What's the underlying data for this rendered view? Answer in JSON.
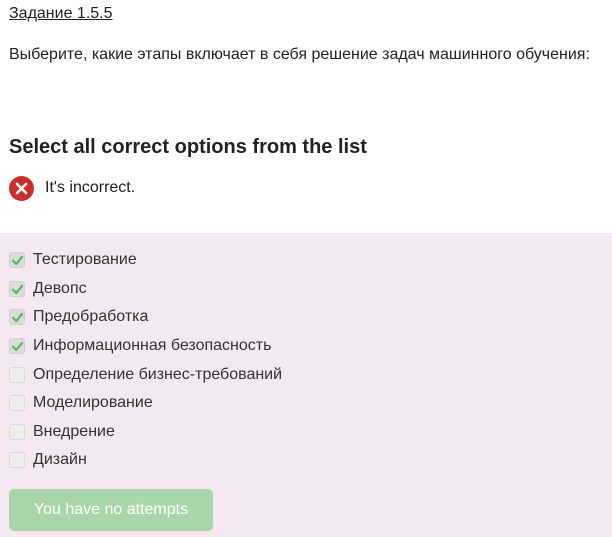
{
  "task": {
    "title": "Задание 1.5.5",
    "question": "Выберите, какие этапы включает в себя решение задач машинного обучения:"
  },
  "quiz": {
    "instruction": "Select all correct options from the list",
    "status_icon": "x-circle-icon",
    "status_color": "#c9302c",
    "status_text": "It's incorrect.",
    "check_color": "#5cb85c",
    "options": [
      {
        "label": "Тестирование",
        "checked": true
      },
      {
        "label": "Девопс",
        "checked": true
      },
      {
        "label": "Предобработка",
        "checked": true
      },
      {
        "label": "Информационная безопасность",
        "checked": true
      },
      {
        "label": "Определение бизнес-требований",
        "checked": false
      },
      {
        "label": "Моделирование",
        "checked": false
      },
      {
        "label": "Внедрение",
        "checked": false
      },
      {
        "label": "Дизайн",
        "checked": false
      }
    ],
    "submit_label": "You have no attempts",
    "submit_color": "#a9d6a9"
  }
}
